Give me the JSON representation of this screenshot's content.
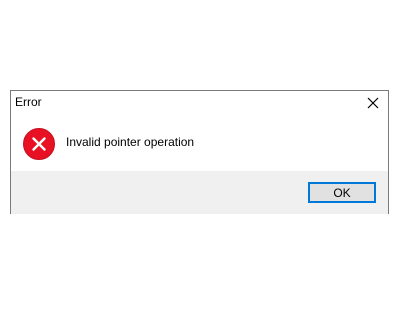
{
  "dialog": {
    "title": "Error",
    "message": "Invalid pointer operation",
    "ok_label": "OK",
    "close_icon": "close-icon",
    "status_icon": "error-icon"
  },
  "colors": {
    "error_red": "#e81123",
    "accent_blue": "#0078d7",
    "footer_bg": "#f0f0f0"
  }
}
